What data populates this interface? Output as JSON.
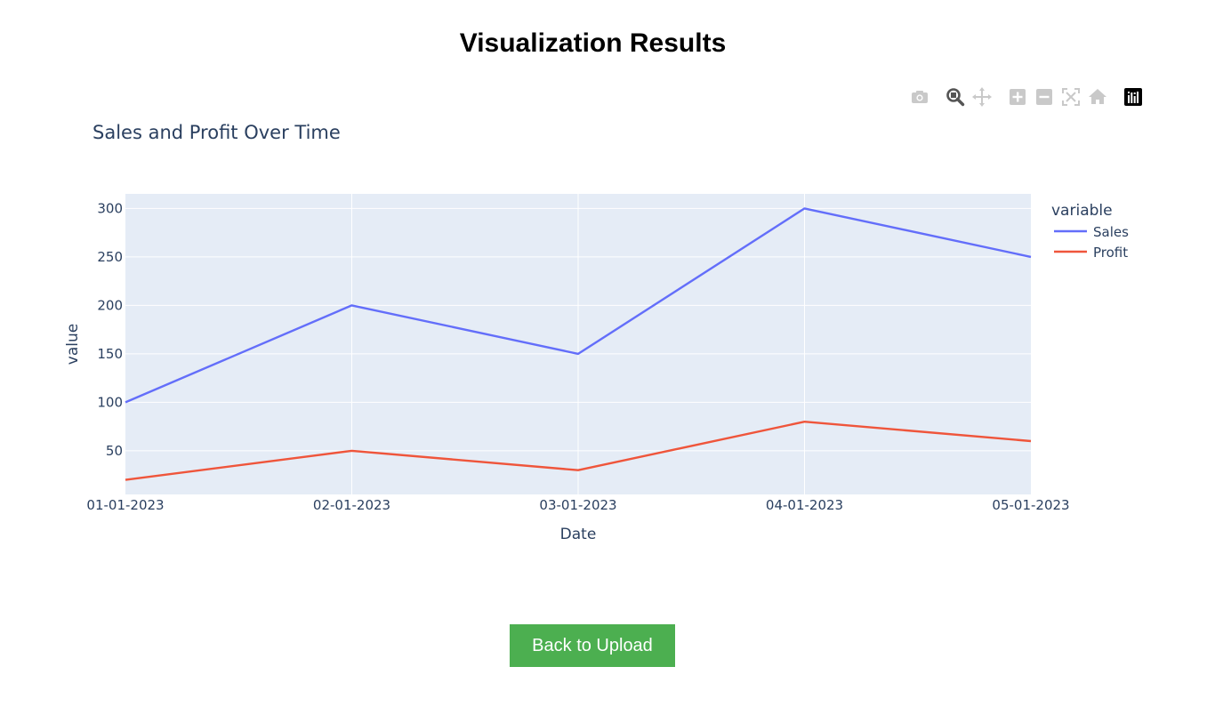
{
  "page": {
    "title": "Visualization Results",
    "back_button_label": "Back to Upload",
    "back_button_color": "#4caf50"
  },
  "modebar": {
    "buttons": [
      {
        "name": "camera-icon"
      },
      {
        "name": "zoom-icon"
      },
      {
        "name": "pan-icon"
      },
      {
        "name": "zoom-in-icon"
      },
      {
        "name": "zoom-out-icon"
      },
      {
        "name": "autoscale-icon"
      },
      {
        "name": "home-icon"
      },
      {
        "name": "plotly-logo-icon"
      }
    ]
  },
  "chart_data": {
    "type": "line",
    "title": "Sales and Profit Over Time",
    "xlabel": "Date",
    "ylabel": "value",
    "categories": [
      "01-01-2023",
      "02-01-2023",
      "03-01-2023",
      "04-01-2023",
      "05-01-2023"
    ],
    "series": [
      {
        "name": "Sales",
        "values": [
          100,
          200,
          150,
          300,
          250
        ],
        "color": "#636efa"
      },
      {
        "name": "Profit",
        "values": [
          20,
          50,
          30,
          80,
          60
        ],
        "color": "#ef553b"
      }
    ],
    "ylim": [
      5,
      315
    ],
    "yticks": [
      50,
      100,
      150,
      200,
      250,
      300
    ],
    "legend": {
      "title": "variable",
      "position": "right"
    },
    "grid": true,
    "plot_background": "#e5ecf6"
  }
}
